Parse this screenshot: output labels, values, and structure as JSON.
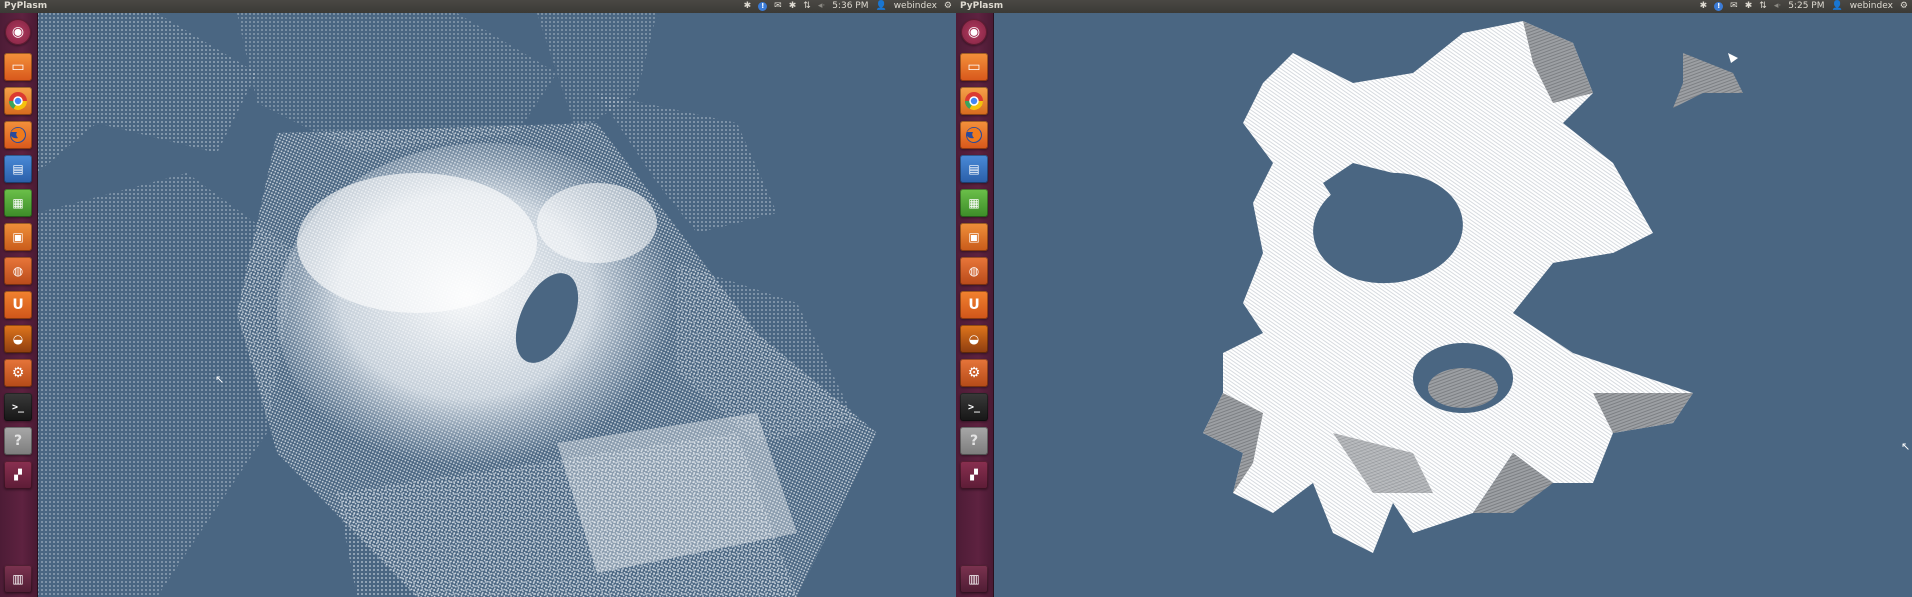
{
  "screens": [
    {
      "topbar": {
        "title": "PyPlasm",
        "time": "5:36 PM",
        "user": "webindex"
      },
      "launcher_icons": [
        "ubuntu-dash-icon",
        "files-icon",
        "chrome-icon",
        "firefox-icon",
        "writer-icon",
        "calc-icon",
        "impress-icon",
        "software-center-icon",
        "ubuntu-one-icon",
        "blender-icon",
        "system-settings-icon",
        "terminal-icon",
        "help-icon",
        "workspace-switcher-icon",
        "trash-icon"
      ],
      "viewport": {
        "background": "#4a6682",
        "render": "point-cloud"
      }
    },
    {
      "topbar": {
        "title": "PyPlasm",
        "time": "5:25 PM",
        "user": "webindex"
      },
      "launcher_icons": [
        "ubuntu-dash-icon",
        "files-icon",
        "chrome-icon",
        "firefox-icon",
        "writer-icon",
        "calc-icon",
        "impress-icon",
        "software-center-icon",
        "ubuntu-one-icon",
        "blender-icon",
        "system-settings-icon",
        "terminal-icon",
        "help-icon",
        "workspace-switcher-icon",
        "trash-icon"
      ],
      "viewport": {
        "background": "#4a6682",
        "render": "voxel-surface"
      }
    }
  ],
  "colors": {
    "launcher": "#5e2240",
    "topbar": "#3c3b37",
    "viewport_bg": "#4a6682",
    "info_badge": "#3b7bd6"
  }
}
